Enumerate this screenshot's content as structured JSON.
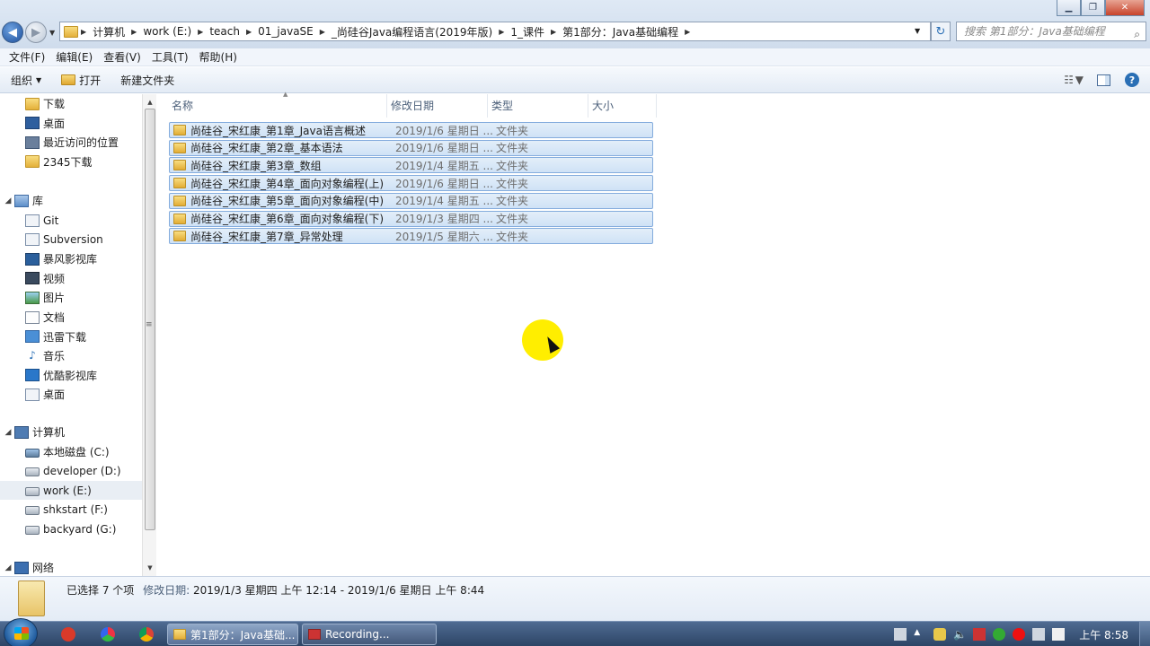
{
  "window": {
    "controls": {
      "minimize": "▁",
      "maximize": "❐",
      "close": "✕"
    }
  },
  "nav": {
    "back_glyph": "◀",
    "forward_glyph": "▶",
    "dropdown_glyph": "▼"
  },
  "breadcrumb": [
    "计算机",
    "work (E:)",
    "teach",
    "01_javaSE",
    "_尚硅谷Java编程语言(2019年版)",
    "1_课件",
    "第1部分：Java基础编程"
  ],
  "search": {
    "placeholder": "搜索 第1部分：Java基础编程"
  },
  "menu": [
    "文件(F)",
    "编辑(E)",
    "查看(V)",
    "工具(T)",
    "帮助(H)"
  ],
  "toolbar": {
    "organize": "组织",
    "open": "打开",
    "new_folder": "新建文件夹"
  },
  "sidebar": {
    "favorites": [
      "下载",
      "桌面",
      "最近访问的位置",
      "2345下载"
    ],
    "libraries_label": "库",
    "libraries": [
      "Git",
      "Subversion",
      "暴风影视库",
      "视频",
      "图片",
      "文档",
      "迅雷下载",
      "音乐",
      "优酷影视库",
      "桌面"
    ],
    "computer_label": "计算机",
    "drives": [
      "本地磁盘 (C:)",
      "developer (D:)",
      "work (E:)",
      "shkstart (F:)",
      "backyard (G:)"
    ],
    "network_label": "网络"
  },
  "columns": {
    "name": "名称",
    "date": "修改日期",
    "type": "类型",
    "size": "大小"
  },
  "files": [
    {
      "name": "尚硅谷_宋红康_第1章_Java语言概述",
      "date": "2019/1/6 星期日 ...",
      "type": "文件夹"
    },
    {
      "name": "尚硅谷_宋红康_第2章_基本语法",
      "date": "2019/1/6 星期日 ...",
      "type": "文件夹"
    },
    {
      "name": "尚硅谷_宋红康_第3章_数组",
      "date": "2019/1/4 星期五 ...",
      "type": "文件夹"
    },
    {
      "name": "尚硅谷_宋红康_第4章_面向对象编程(上)",
      "date": "2019/1/6 星期日 ...",
      "type": "文件夹"
    },
    {
      "name": "尚硅谷_宋红康_第5章_面向对象编程(中)",
      "date": "2019/1/4 星期五 ...",
      "type": "文件夹"
    },
    {
      "name": "尚硅谷_宋红康_第6章_面向对象编程(下)",
      "date": "2019/1/3 星期四 ...",
      "type": "文件夹"
    },
    {
      "name": "尚硅谷_宋红康_第7章_异常处理",
      "date": "2019/1/5 星期六 ...",
      "type": "文件夹"
    }
  ],
  "details": {
    "selected": "已选择 7 个项",
    "modified_label": "修改日期:",
    "modified_range": "2019/1/3 星期四 上午 12:14 - 2019/1/6 星期日 上午 8:44"
  },
  "taskbar": {
    "tasks": [
      "第1部分：Java基础...",
      "Recording..."
    ],
    "clock": "上午 8:58"
  },
  "colors": {
    "selection": "#cfe2f6",
    "selection_border": "#84acdd",
    "highlight": "#ffee00"
  }
}
